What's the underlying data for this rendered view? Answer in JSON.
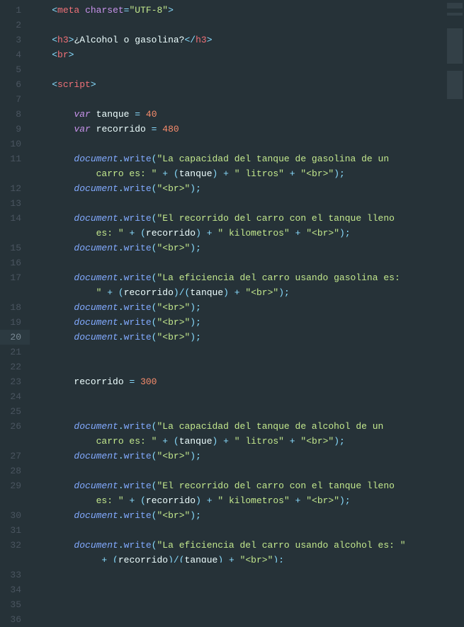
{
  "editor": {
    "current_line": 20,
    "gutter": [
      "1",
      "2",
      "3",
      "4",
      "5",
      "6",
      "7",
      "8",
      "9",
      "10",
      "11",
      "",
      "12",
      "13",
      "14",
      "",
      "15",
      "16",
      "17",
      "",
      "18",
      "19",
      "20",
      "21",
      "22",
      "23",
      "24",
      "25",
      "26",
      "",
      "27",
      "28",
      "29",
      "",
      "30",
      "31",
      "32",
      "",
      "33",
      "34",
      "35",
      "36"
    ]
  },
  "tokens": {
    "meta": "meta",
    "charset_attr": "charset",
    "charset_val": "\"UTF-8\"",
    "h3": "h3",
    "h3_text": "¿Alcohol o gasolina?",
    "br": "br",
    "script": "script",
    "var": "var",
    "tanque": "tanque",
    "recorrido": "recorrido",
    "n40": "40",
    "n480": "480",
    "n300": "300",
    "document": "document",
    "write": "write",
    "s_cap_gas": "\"La capacidad del tanque de gasolina de un ",
    "s_cap_gas2": "carro es: \"",
    "s_litros": "\" litros\"",
    "s_br": "\"<br>\"",
    "s_rec_full": "\"El recorrido del carro con el tanque lleno ",
    "s_rec_full2": "es: \"",
    "s_km": "\" kilometros\"",
    "s_eff_gas": "\"La eficiencia del carro usando gasolina es: ",
    "s_eff_gas2": "\"",
    "s_cap_alc": "\"La capacidad del tanque de alcohol de un ",
    "s_cap_alc2": "carro es: \"",
    "s_eff_alc": "\"La eficiencia del carro usando alcohol es: \"",
    "s_eff_alc_cont": ""
  }
}
